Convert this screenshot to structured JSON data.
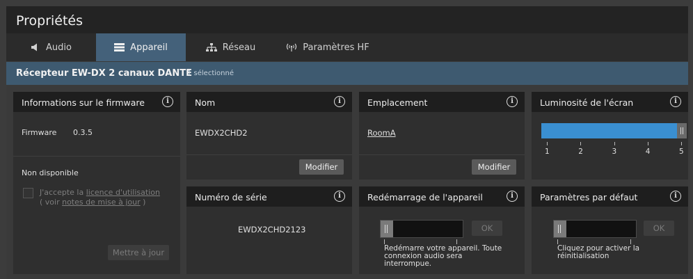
{
  "window": {
    "title": "Propriétés"
  },
  "tabs": [
    {
      "label": "Audio",
      "icon": "speaker-icon",
      "active": false
    },
    {
      "label": "Appareil",
      "icon": "device-icon",
      "active": true
    },
    {
      "label": "Réseau",
      "icon": "network-icon",
      "active": false
    },
    {
      "label": "Paramètres HF",
      "icon": "antenna-icon",
      "active": false
    }
  ],
  "device_bar": {
    "name": "Récepteur EW-DX 2 canaux DANTE",
    "selection": "1 sélectionné"
  },
  "firmware": {
    "title": "Informations sur le firmware",
    "label": "Firmware",
    "version": "0.3.5",
    "status": "Non disponible",
    "accept_prefix": "J'accepte la ",
    "license_link": "licence d'utilisation",
    "notes_prefix": "( voir ",
    "notes_link": "notes de mise à jour",
    "notes_suffix": " )",
    "update_button": "Mettre à jour"
  },
  "name_panel": {
    "title": "Nom",
    "value": "EWDX2CHD2",
    "edit_button": "Modifier"
  },
  "location_panel": {
    "title": "Emplacement",
    "value": "RoomA",
    "edit_button": "Modifier"
  },
  "brightness_panel": {
    "title": "Luminosité de l'écran",
    "level": 5,
    "ticks": [
      "1",
      "2",
      "3",
      "4",
      "5"
    ],
    "accent": "#3a8fd1"
  },
  "serial_panel": {
    "title": "Numéro de série",
    "value": "EWDX2CHD2123"
  },
  "restart_panel": {
    "title": "Redémarrage de l'appareil",
    "ok_button": "OK",
    "description": "Redémarre votre appareil. Toute connexion audio sera interrompue."
  },
  "defaults_panel": {
    "title": "Paramètres par défaut",
    "ok_button": "OK",
    "description": "Cliquez pour activer la réinitialisation"
  }
}
